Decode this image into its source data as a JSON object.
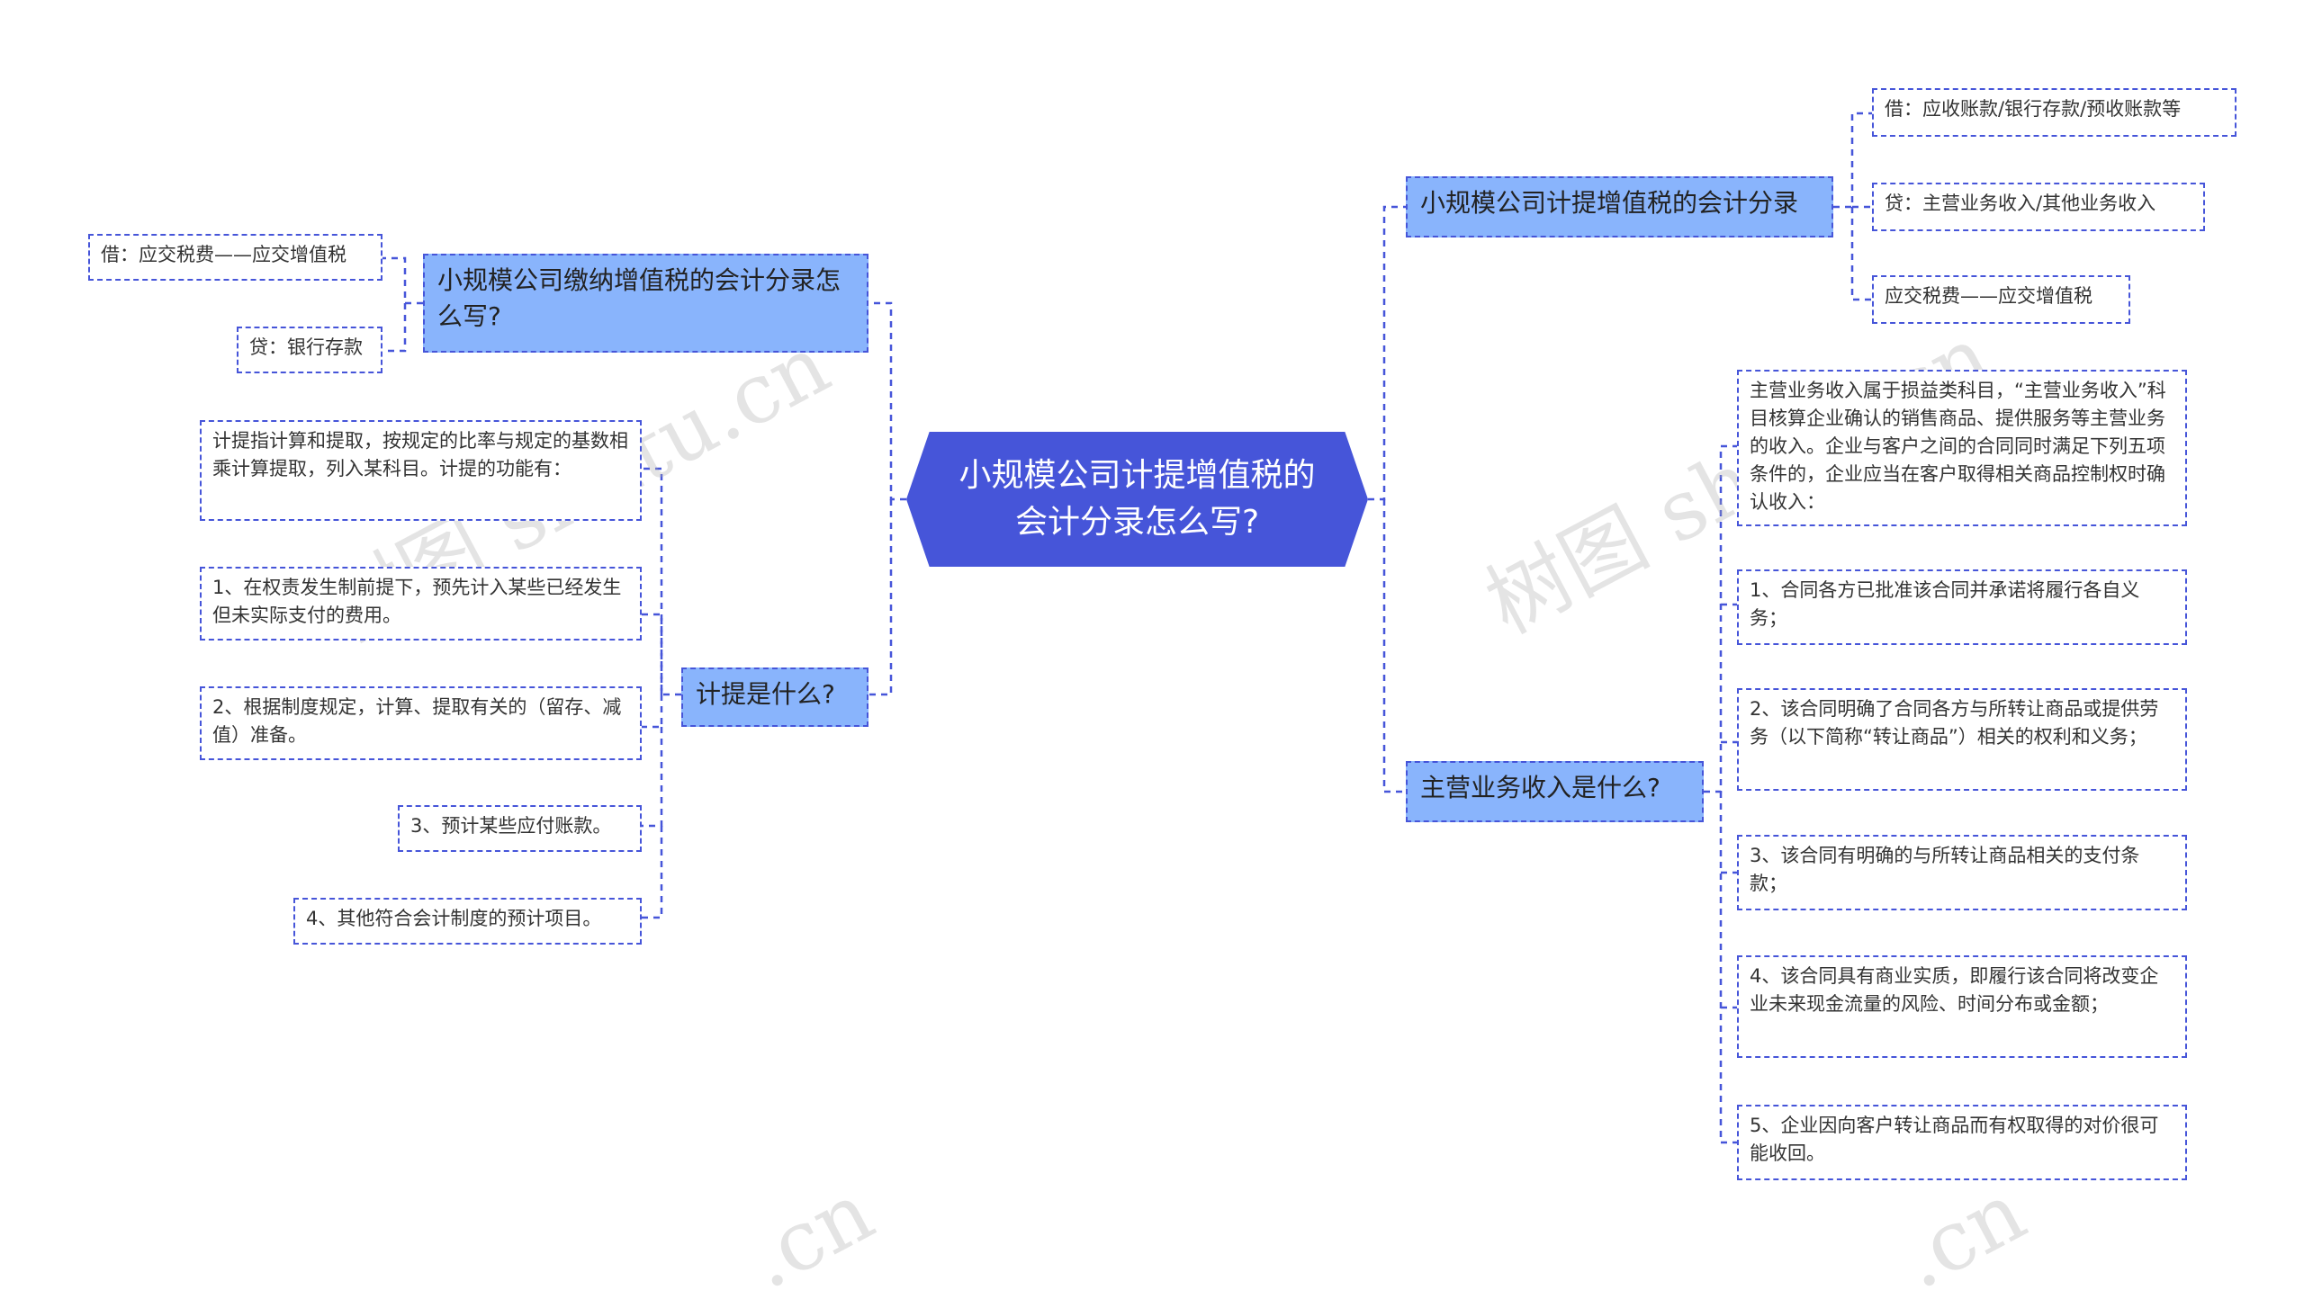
{
  "root": {
    "title": "小规模公司计提增值税的会计分录怎么写?"
  },
  "left": {
    "payment": {
      "label": "小规模公司缴纳增值税的会计分录怎么写?",
      "items": [
        "借：应交税费——应交增值税",
        "贷：银行存款"
      ]
    },
    "accrual": {
      "label": "计提是什么?",
      "items": [
        "计提指计算和提取，按规定的比率与规定的基数相乘计算提取，列入某科目。计提的功能有：",
        "1、在权责发生制前提下，预先计入某些已经发生但未实际支付的费用。",
        "2、根据制度规定，计算、提取有关的（留存、减值）准备。",
        "3、预计某些应付账款。",
        "4、其他符合会计制度的预计项目。"
      ]
    }
  },
  "right": {
    "entry": {
      "label": "小规模公司计提增值税的会计分录",
      "items": [
        "借：应收账款/银行存款/预收账款等",
        "贷：主营业务收入/其他业务收入",
        "应交税费——应交增值税"
      ]
    },
    "revenue": {
      "label": "主营业务收入是什么?",
      "items": [
        "主营业务收入属于损益类科目，“主营业务收入”科目核算企业确认的销售商品、提供服务等主营业务的收入。企业与客户之间的合同同时满足下列五项条件的，企业应当在客户取得相关商品控制权时确认收入：",
        "1、合同各方已批准该合同并承诺将履行各自义务；",
        "2、该合同明确了合同各方与所转让商品或提供劳务（以下简称“转让商品”）相关的权利和义务；",
        "3、该合同有明确的与所转让商品相关的支付条款；",
        "4、该合同具有商业实质，即履行该合同将改变企业未来现金流量的风险、时间分布或金额；",
        "5、企业因向客户转让商品而有权取得的对价很可能收回。"
      ]
    }
  },
  "watermark": {
    "text_a": "树图 shutu.cn",
    "text_b": ".cn"
  },
  "colors": {
    "root": "#4655d9",
    "main": "#89b4fc",
    "line": "#4655d9"
  }
}
